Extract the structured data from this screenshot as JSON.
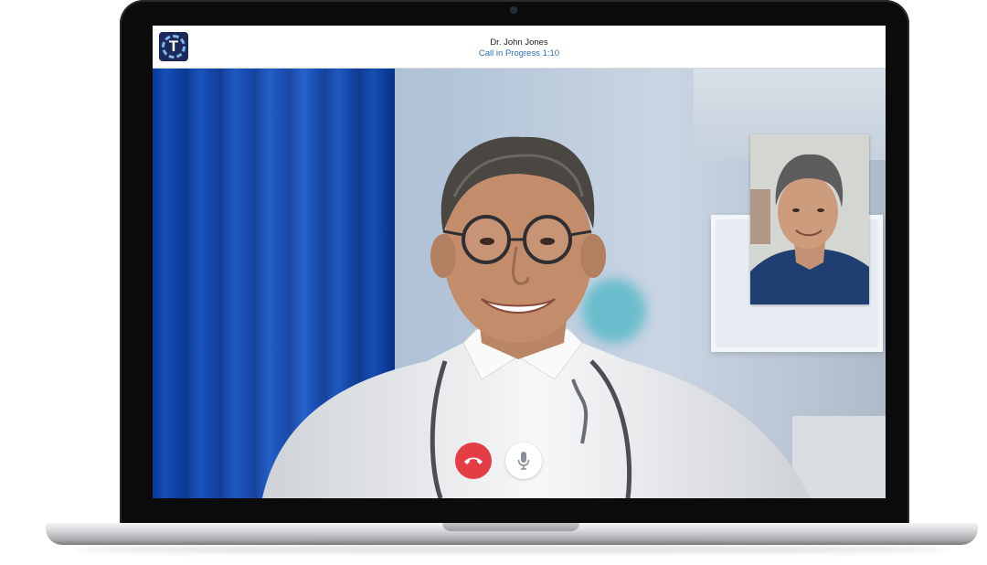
{
  "header": {
    "logo_letter": "T",
    "caller_name": "Dr. John Jones",
    "call_status": "Call in Progress 1:10"
  },
  "controls": {
    "end_call": {
      "icon": "phone-hangup-icon",
      "color": "#e53d45"
    },
    "mute": {
      "icon": "microphone-icon",
      "color": "#ffffff"
    }
  },
  "colors": {
    "brand": "#1b2a5a",
    "status_text": "#2f6fb3"
  }
}
